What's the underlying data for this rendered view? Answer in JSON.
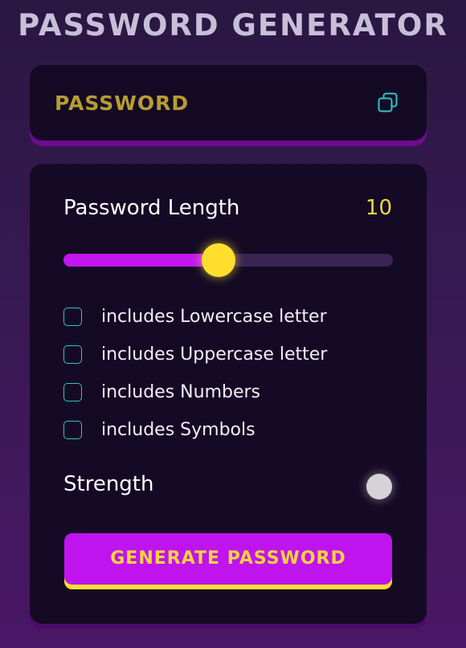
{
  "app": {
    "title": "PASSWORD GENERATOR"
  },
  "display": {
    "placeholder": "PASSWORD",
    "copy_icon": "copy-icon"
  },
  "length": {
    "label": "Password Length",
    "value": "10",
    "slider_fraction": 0.47
  },
  "options": [
    {
      "label": "includes Lowercase letter",
      "checked": false
    },
    {
      "label": "includes Uppercase letter",
      "checked": false
    },
    {
      "label": "includes Numbers",
      "checked": false
    },
    {
      "label": "includes Symbols",
      "checked": false
    }
  ],
  "strength": {
    "label": "Strength",
    "indicator_color": "#d5d3d8"
  },
  "generate": {
    "label": "GENERATE PASSWORD"
  },
  "colors": {
    "accent": "#c014ef",
    "highlight": "#ffde2e",
    "checkbox_border": "#2ec5c8",
    "placeholder_text": "#b79d30",
    "panel_bg": "#150a25"
  }
}
